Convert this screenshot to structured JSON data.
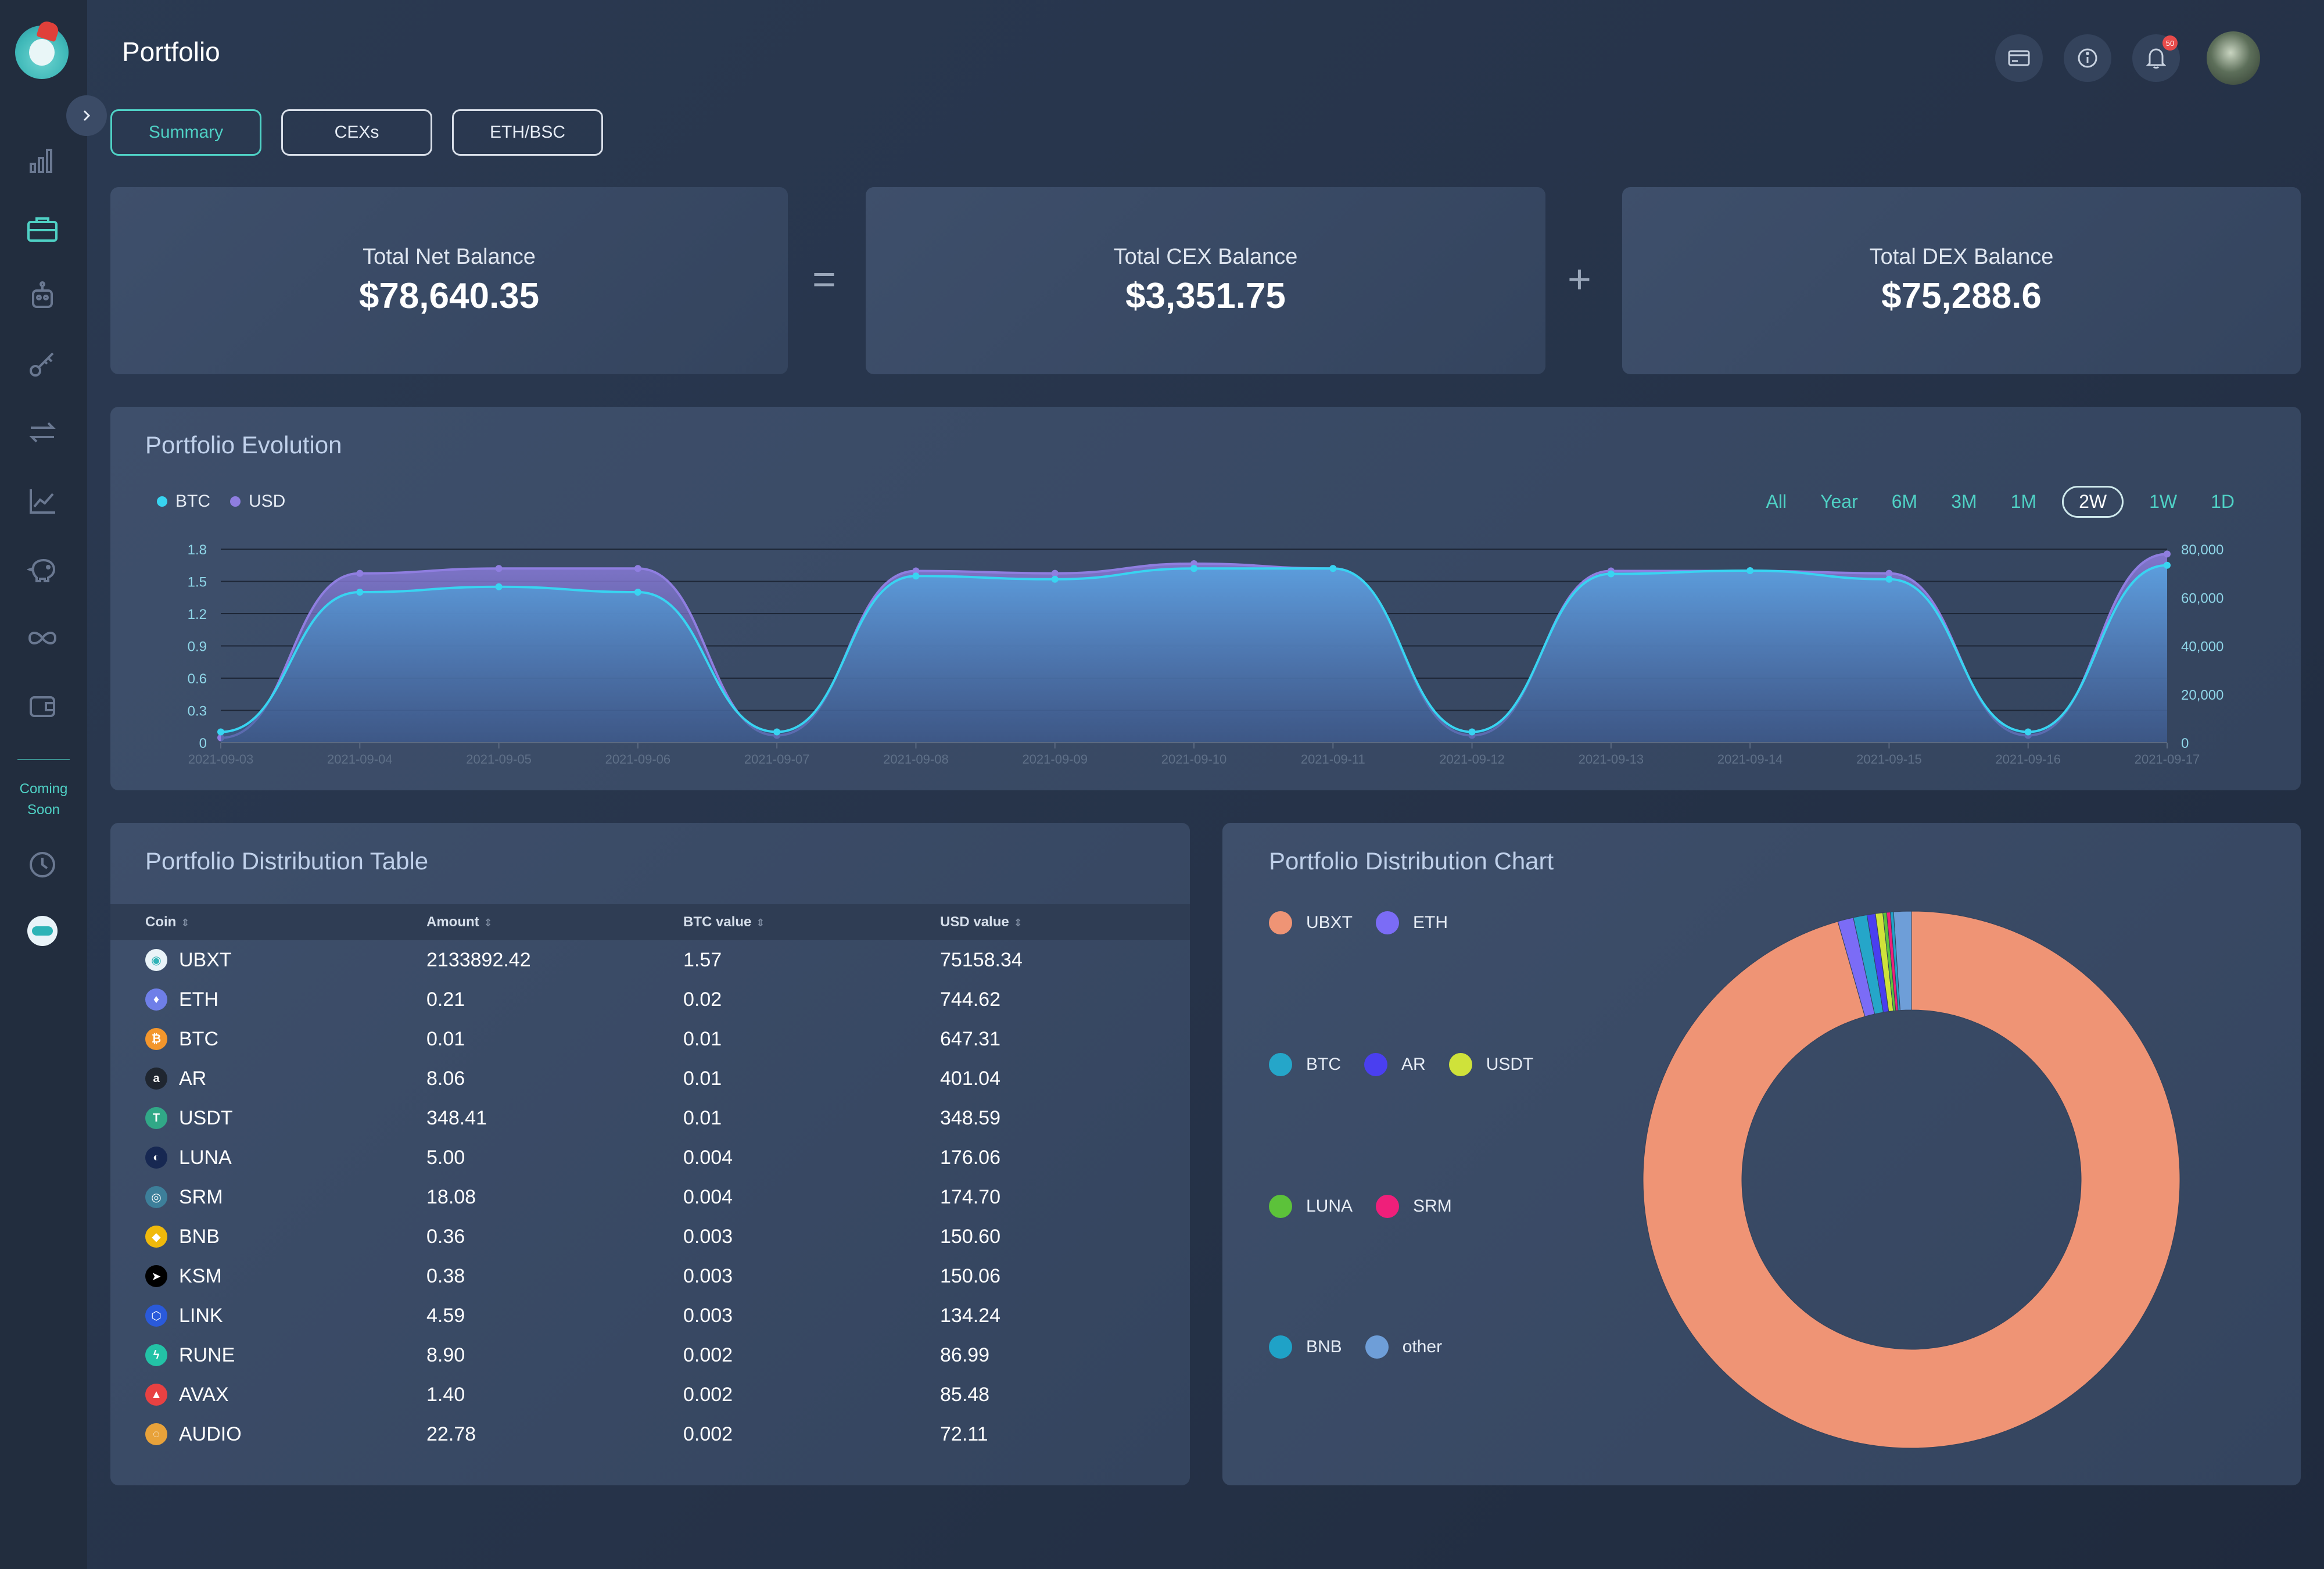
{
  "page_title": "Portfolio",
  "sidebar": {
    "coming_soon": "Coming\nSoon",
    "items": [
      {
        "icon": "bar-chart-icon"
      },
      {
        "icon": "briefcase-icon"
      },
      {
        "icon": "robot-icon"
      },
      {
        "icon": "key-icon"
      },
      {
        "icon": "swap-icon"
      },
      {
        "icon": "line-chart-icon"
      },
      {
        "icon": "piggy-bank-icon"
      },
      {
        "icon": "infinity-icon"
      },
      {
        "icon": "wallet-icon"
      },
      {
        "icon": "clock-icon"
      },
      {
        "icon": "ubxt-icon"
      }
    ]
  },
  "header": {
    "notification_count": "50"
  },
  "tabs": [
    {
      "label": "Summary",
      "active": true
    },
    {
      "label": "CEXs",
      "active": false
    },
    {
      "label": "ETH/BSC",
      "active": false
    }
  ],
  "balances": {
    "net": {
      "label": "Total Net Balance",
      "value": "$78,640.35"
    },
    "equals": "=",
    "cex": {
      "label": "Total CEX Balance",
      "value": "$3,351.75"
    },
    "plus": "+",
    "dex": {
      "label": "Total DEX Balance",
      "value": "$75,288.6"
    }
  },
  "evolution": {
    "title": "Portfolio Evolution",
    "legend": [
      {
        "name": "BTC",
        "color": "#38d4f1"
      },
      {
        "name": "USD",
        "color": "#8f7ee0"
      }
    ],
    "ranges": [
      "All",
      "Year",
      "6M",
      "3M",
      "1M",
      "2W",
      "1W",
      "1D"
    ],
    "active_range": "2W"
  },
  "chart_data": [
    {
      "type": "area",
      "x": [
        "2021-09-03",
        "2021-09-04",
        "2021-09-05",
        "2021-09-06",
        "2021-09-07",
        "2021-09-08",
        "2021-09-09",
        "2021-09-10",
        "2021-09-11",
        "2021-09-12",
        "2021-09-13",
        "2021-09-14",
        "2021-09-15",
        "2021-09-16",
        "2021-09-17"
      ],
      "series": [
        {
          "name": "BTC",
          "axis": "left",
          "color": "#38d4f1",
          "values": [
            0.1,
            1.4,
            1.45,
            1.4,
            0.1,
            1.55,
            1.52,
            1.62,
            1.62,
            0.1,
            1.57,
            1.6,
            1.52,
            0.1,
            1.65
          ]
        },
        {
          "name": "USD",
          "axis": "right",
          "color": "#8f7ee0",
          "values": [
            2000,
            70000,
            72000,
            72000,
            3000,
            71000,
            70000,
            74000,
            72000,
            3000,
            71000,
            71000,
            70000,
            3000,
            78000
          ]
        }
      ],
      "yticks_left": [
        "0",
        "0.3",
        "0.6",
        "0.9",
        "1.2",
        "1.5",
        "1.8"
      ],
      "ylim_left": [
        0,
        1.8
      ],
      "yticks_right": [
        "0",
        "20,000",
        "40,000",
        "60,000",
        "80,000"
      ],
      "ylim_right": [
        0,
        80000
      ]
    },
    {
      "type": "pie",
      "title": "Portfolio Distribution Chart",
      "labels": [
        "UBXT",
        "ETH",
        "BTC",
        "AR",
        "USDT",
        "LUNA",
        "SRM",
        "BNB",
        "other"
      ],
      "values": [
        75158.34,
        744.62,
        647.31,
        401.04,
        348.59,
        176.06,
        174.7,
        150.6,
        838.09
      ],
      "colors": [
        "#ef9475",
        "#7b6cf6",
        "#25a6c9",
        "#4a3ff0",
        "#cfe23a",
        "#5cc23a",
        "#ef1f7a",
        "#1fa2c7",
        "#6e9ed8"
      ]
    }
  ],
  "table": {
    "title": "Portfolio Distribution Table",
    "columns": [
      "Coin",
      "Amount",
      "BTC value",
      "USD value"
    ],
    "rows": [
      {
        "coin": "UBXT",
        "amount": "2133892.42",
        "btc": "1.57",
        "usd": "75158.34",
        "color": "#e9f3f8",
        "glyph": "◉"
      },
      {
        "coin": "ETH",
        "amount": "0.21",
        "btc": "0.02",
        "usd": "744.62",
        "color": "#6f7fe8",
        "glyph": "♦"
      },
      {
        "coin": "BTC",
        "amount": "0.01",
        "btc": "0.01",
        "usd": "647.31",
        "color": "#f3962c",
        "glyph": "₿"
      },
      {
        "coin": "AR",
        "amount": "8.06",
        "btc": "0.01",
        "usd": "401.04",
        "color": "#1f2630",
        "glyph": "a"
      },
      {
        "coin": "USDT",
        "amount": "348.41",
        "btc": "0.01",
        "usd": "348.59",
        "color": "#31a887",
        "glyph": "T"
      },
      {
        "coin": "LUNA",
        "amount": "5.00",
        "btc": "0.004",
        "usd": "176.06",
        "color": "#172852",
        "glyph": "◐"
      },
      {
        "coin": "SRM",
        "amount": "18.08",
        "btc": "0.004",
        "usd": "174.70",
        "color": "#3d7f9a",
        "glyph": "◎"
      },
      {
        "coin": "BNB",
        "amount": "0.36",
        "btc": "0.003",
        "usd": "150.60",
        "color": "#f0b90b",
        "glyph": "◆"
      },
      {
        "coin": "KSM",
        "amount": "0.38",
        "btc": "0.003",
        "usd": "150.06",
        "color": "#000000",
        "glyph": "➤"
      },
      {
        "coin": "LINK",
        "amount": "4.59",
        "btc": "0.003",
        "usd": "134.24",
        "color": "#2a5ada",
        "glyph": "⬡"
      },
      {
        "coin": "RUNE",
        "amount": "8.90",
        "btc": "0.002",
        "usd": "86.99",
        "color": "#23c2a6",
        "glyph": "ϟ"
      },
      {
        "coin": "AVAX",
        "amount": "1.40",
        "btc": "0.002",
        "usd": "85.48",
        "color": "#e84142",
        "glyph": "▲"
      },
      {
        "coin": "AUDIO",
        "amount": "22.78",
        "btc": "0.002",
        "usd": "72.11",
        "color": "#e8a23a",
        "glyph": "◌"
      }
    ]
  }
}
